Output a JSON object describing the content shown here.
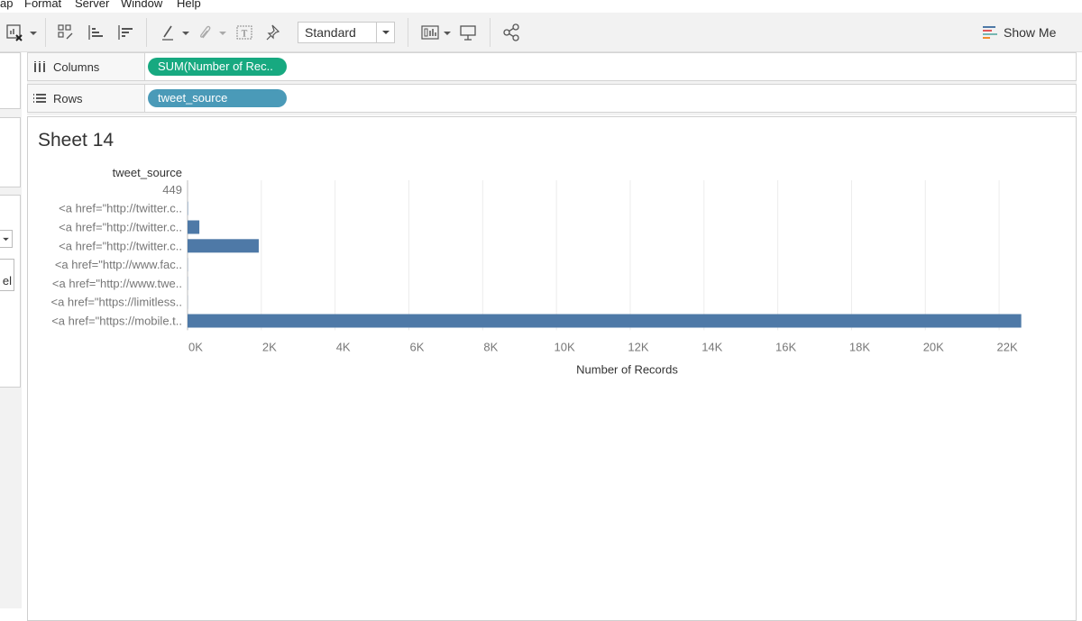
{
  "menu": {
    "items": [
      "ap",
      "Format",
      "Server",
      "Window",
      "Help"
    ]
  },
  "toolbar": {
    "fit_value": "Standard",
    "show_me_label": "Show Me",
    "icons": [
      "swap-sheet-icon",
      "sort-ascending-icon",
      "sort-descending-icon",
      "highlight-icon",
      "group-icon",
      "label-icon",
      "pin-icon",
      "show-cards-icon",
      "presentation-icon",
      "share-icon"
    ]
  },
  "shelves": {
    "columns_label": "Columns",
    "columns_pill": "SUM(Number of Rec..",
    "rows_label": "Rows",
    "rows_pill": "tweet_source"
  },
  "sheet": {
    "title": "Sheet 14"
  },
  "left_pane": {
    "fragment_text": "el"
  },
  "colors": {
    "bar": "#4e79a7",
    "columns_pill": "#17a980",
    "rows_pill": "#4a9ab8"
  },
  "chart_data": {
    "type": "bar",
    "orientation": "horizontal",
    "row_header": "tweet_source",
    "categories": [
      "449",
      "<a href=\"http://twitter.c..",
      "<a href=\"http://twitter.c..",
      "<a href=\"http://twitter.c..",
      "<a href=\"http://www.fac..",
      "<a href=\"http://www.twe..",
      "<a href=\"https://limitless..",
      "<a href=\"https://mobile.t.."
    ],
    "values": [
      1,
      10,
      320,
      1930,
      5,
      5,
      3,
      22600
    ],
    "xlabel": "Number of Records",
    "xlim": [
      0,
      23000
    ],
    "x_ticks": [
      "0K",
      "2K",
      "4K",
      "6K",
      "8K",
      "10K",
      "12K",
      "14K",
      "16K",
      "18K",
      "20K",
      "22K"
    ],
    "x_tick_values": [
      0,
      2000,
      4000,
      6000,
      8000,
      10000,
      12000,
      14000,
      16000,
      18000,
      20000,
      22000
    ],
    "grid": "vertical"
  }
}
